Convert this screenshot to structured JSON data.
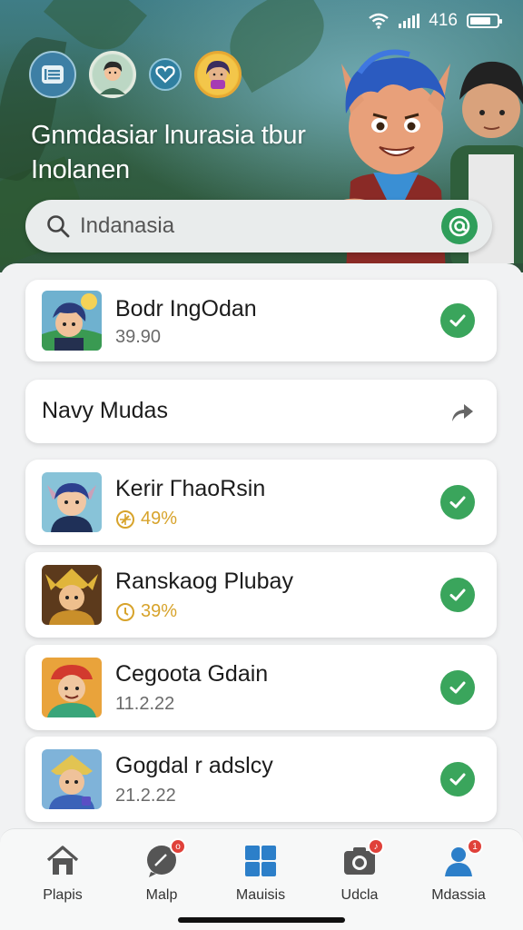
{
  "status_bar": {
    "time": "416"
  },
  "header": {
    "title": "Gnmdasiar lnurasia tbur Inolanen"
  },
  "search": {
    "placeholder": "Indanasia"
  },
  "list": [
    {
      "title": "Bodr IngOdan",
      "subtitle": "39.90",
      "subtitle_icon": "",
      "status": "check-icon"
    },
    {
      "title": "Kerir ΓhaoRsin",
      "subtitle": "49%",
      "subtitle_icon": "compass-icon",
      "status": "check-icon"
    },
    {
      "title": "Ranskaog Plubay",
      "subtitle": "39%",
      "subtitle_icon": "coin-icon",
      "status": "check-icon"
    },
    {
      "title": "Cegoota Gdain",
      "subtitle": "11.2.22",
      "subtitle_icon": "",
      "status": "check-icon"
    },
    {
      "title": "Gogdal r adslcy",
      "subtitle": "21.2.22",
      "subtitle_icon": "",
      "status": "check-icon"
    }
  ],
  "section": {
    "label": "Navy Mudas",
    "action_icon": "share-icon"
  },
  "nav": [
    {
      "label": "Plapis",
      "icon": "home-icon",
      "badge": ""
    },
    {
      "label": "Malp",
      "icon": "message-icon",
      "badge": "o"
    },
    {
      "label": "Mauisis",
      "icon": "grid-icon",
      "badge": ""
    },
    {
      "label": "Udcla",
      "icon": "camera-icon",
      "badge": "♪"
    },
    {
      "label": "Mdassia",
      "icon": "profile-icon",
      "badge": "1"
    }
  ],
  "colors": {
    "accent_green": "#3aa55c",
    "gold": "#d7a32b",
    "badge_red": "#e0413a",
    "nav_blue": "#2c7fc9"
  }
}
